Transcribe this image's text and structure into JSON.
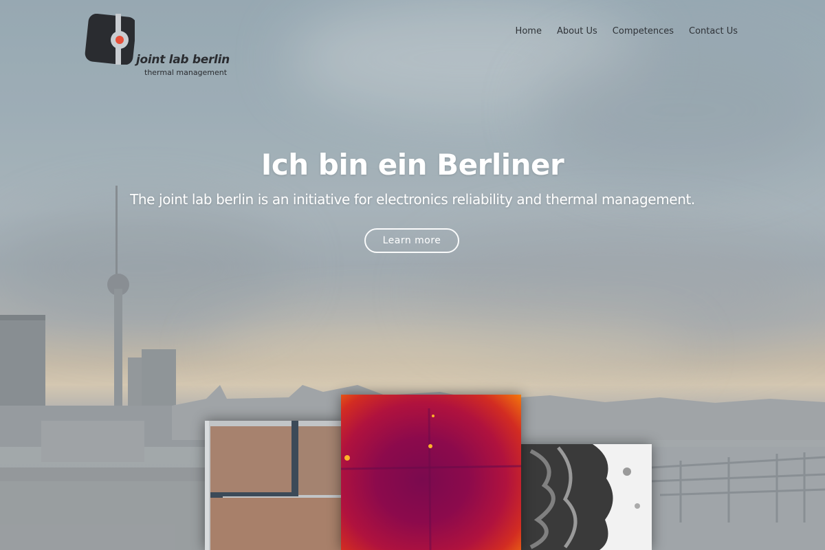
{
  "header": {
    "logo": {
      "name": "joint lab berlin",
      "tagline": "thermal management"
    },
    "nav": [
      {
        "label": "Home"
      },
      {
        "label": "About Us"
      },
      {
        "label": "Competences"
      },
      {
        "label": "Contact Us"
      }
    ]
  },
  "hero": {
    "title": "Ich bin ein Berliner",
    "subtitle": "The joint lab berlin is an initiative for electronics reliability and thermal management.",
    "cta_label": "Learn more"
  },
  "colors": {
    "logo_dark": "#2a2c30",
    "logo_accent": "#e8503a",
    "text_light": "#ffffff"
  },
  "images": [
    {
      "name": "copper-substrate-image"
    },
    {
      "name": "thermal-image"
    },
    {
      "name": "microscope-image"
    }
  ]
}
